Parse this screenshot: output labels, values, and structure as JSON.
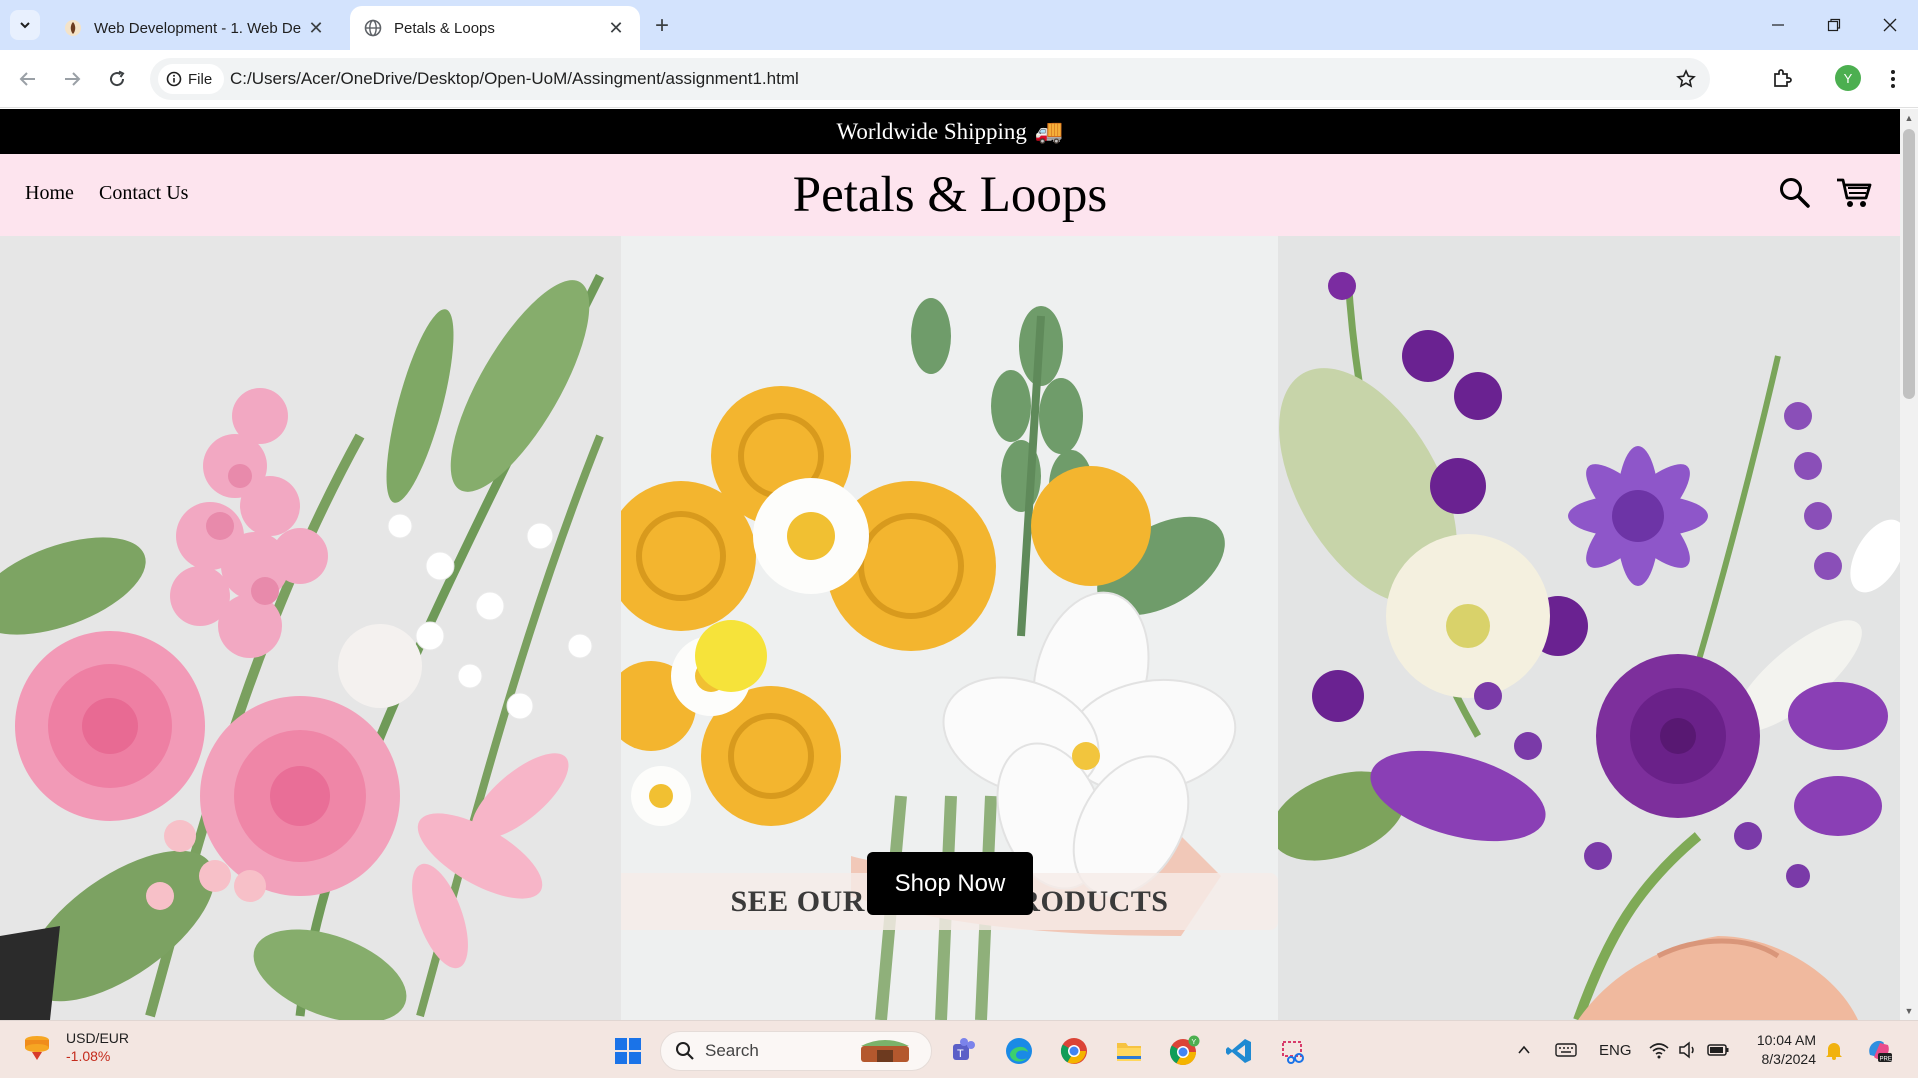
{
  "browser": {
    "tabs": [
      {
        "title": "Web Development - 1. Web De",
        "active": false
      },
      {
        "title": "Petals & Loops",
        "active": true
      }
    ],
    "address": {
      "chip_label": "File",
      "url": "C:/Users/Acer/OneDrive/Desktop/Open-UoM/Assingment/assignment1.html"
    },
    "profile_initial": "Y"
  },
  "site": {
    "shipping_banner": "Worldwide Shipping",
    "shipping_emoji": "🚚",
    "nav": {
      "home": "Home",
      "contact": "Contact Us"
    },
    "brand": "Petals & Loops",
    "hero": {
      "caption": "SEE OUR LATEST PRODUCTS",
      "cta": "Shop Now"
    }
  },
  "taskbar": {
    "widget": {
      "label": "USD/EUR",
      "value": "-1.08%"
    },
    "search_placeholder": "Search",
    "language": "ENG",
    "time": "10:04 AM",
    "date": "8/3/2024"
  }
}
